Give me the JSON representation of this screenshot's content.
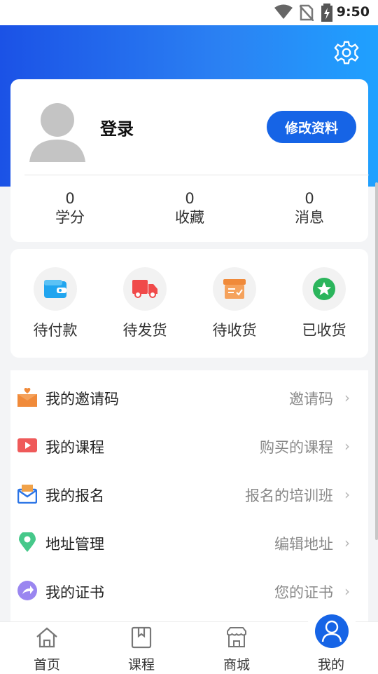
{
  "status_bar": {
    "time": "9:50"
  },
  "profile": {
    "login": "登录",
    "edit_button": "修改资料"
  },
  "stats": [
    {
      "value": "0",
      "label": "学分"
    },
    {
      "value": "0",
      "label": "收藏"
    },
    {
      "value": "0",
      "label": "消息"
    }
  ],
  "orders": [
    {
      "label": "待付款",
      "icon": "wallet-icon",
      "color": "#21a5ef"
    },
    {
      "label": "待发货",
      "icon": "truck-icon",
      "color": "#f04a4a"
    },
    {
      "label": "待收货",
      "icon": "package-icon",
      "color": "#f08a3a"
    },
    {
      "label": "已收货",
      "icon": "star-badge-icon",
      "color": "#2bb55c"
    }
  ],
  "menu": [
    {
      "title": "我的邀请码",
      "subtitle": "邀请码",
      "icon": "invite-icon",
      "color": "#f0883a"
    },
    {
      "title": "我的课程",
      "subtitle": "购买的课程",
      "icon": "video-icon",
      "color": "#ef5a5a"
    },
    {
      "title": "我的报名",
      "subtitle": "报名的培训班",
      "icon": "mail-icon",
      "color": "#2b74e6"
    },
    {
      "title": "地址管理",
      "subtitle": "编辑地址",
      "icon": "location-pin-icon",
      "color": "#46c88a"
    },
    {
      "title": "我的证书",
      "subtitle": "您的证书",
      "icon": "share-arrow-icon",
      "color": "#9a86f0"
    }
  ],
  "nav": {
    "home": "首页",
    "courses": "课程",
    "mall": "商城",
    "me": "我的"
  },
  "colors": {
    "primary": "#1664e6",
    "header_start": "#1b52e6",
    "header_end": "#1fa1ff"
  }
}
